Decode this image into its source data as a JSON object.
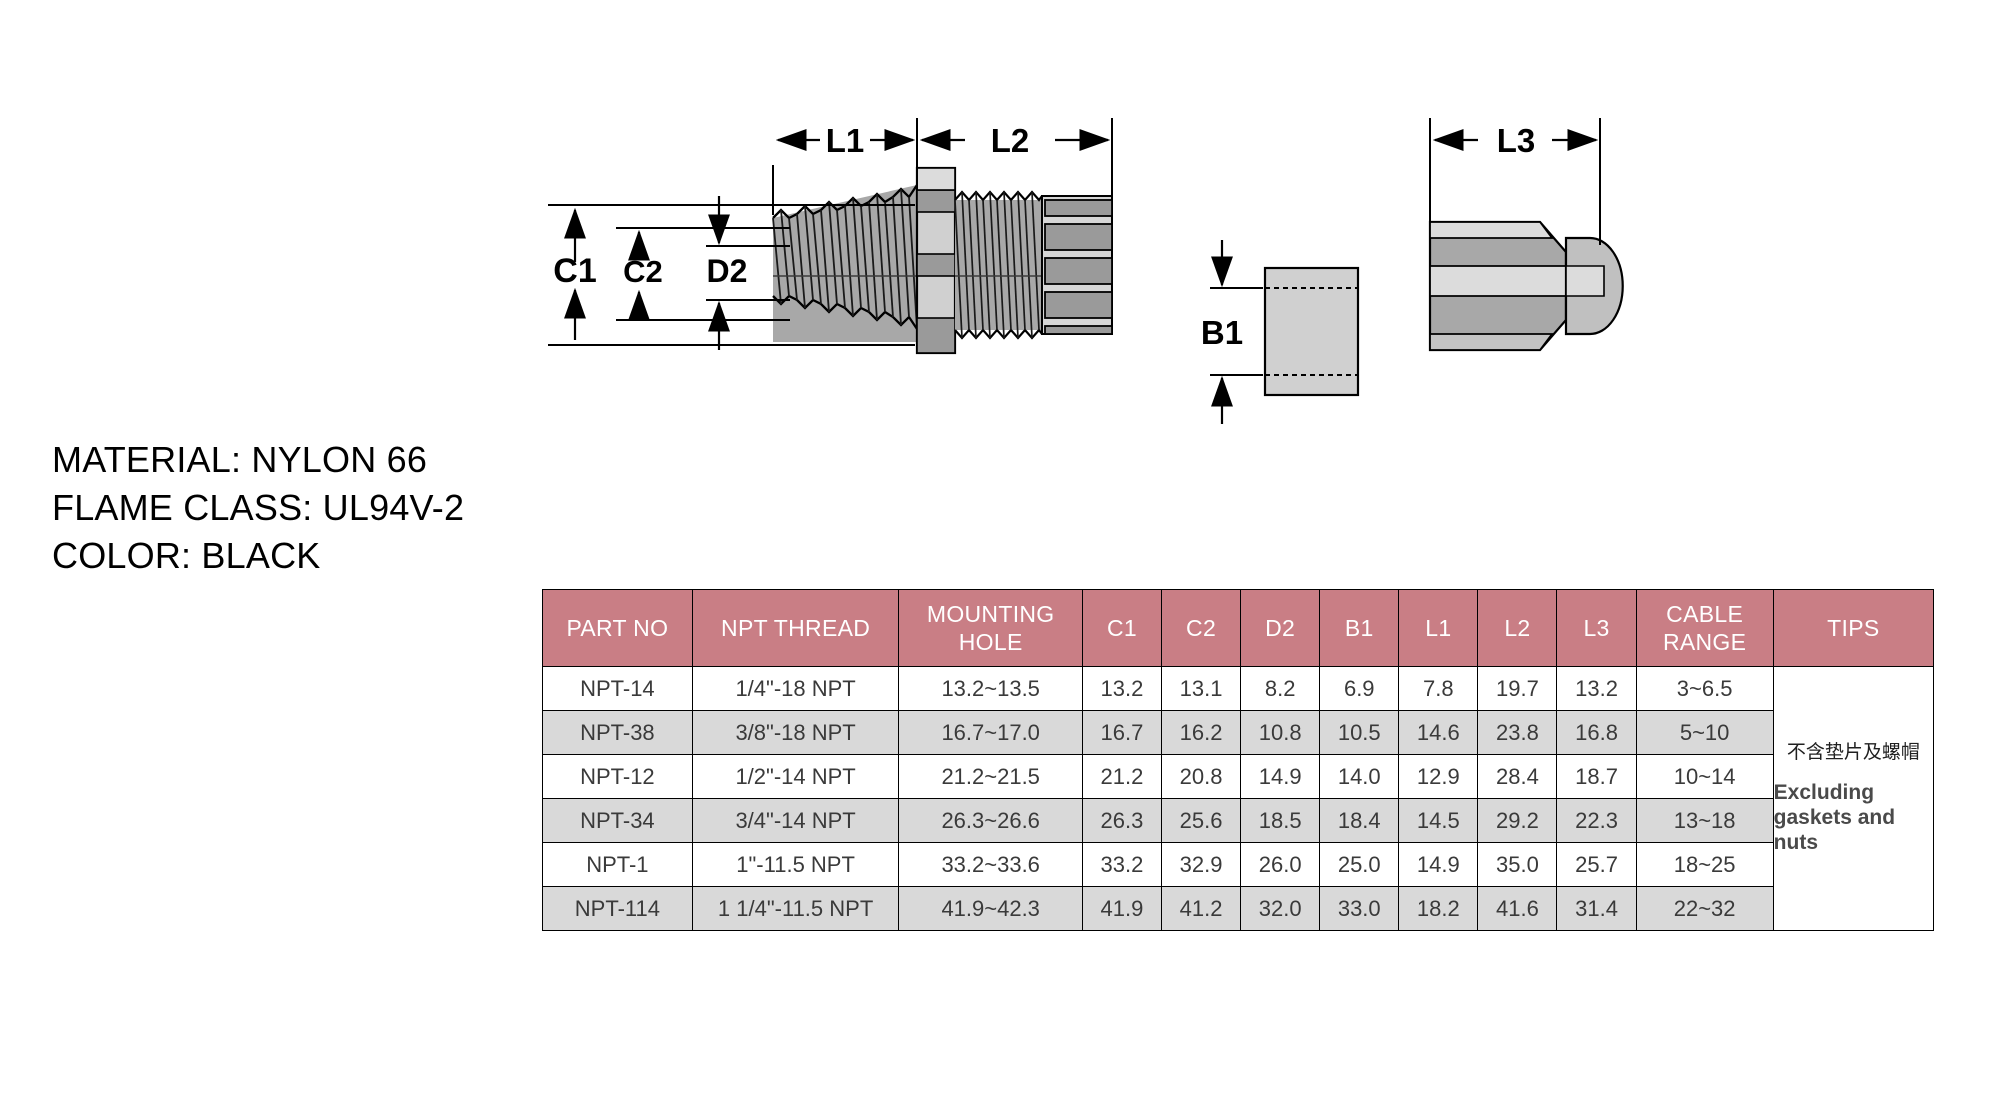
{
  "spec": {
    "lines": [
      "MATERIAL: NYLON 66",
      "FLAME CLASS: UL94V-2",
      "COLOR: BLACK"
    ]
  },
  "drawing": {
    "labels": {
      "l1": "L1",
      "l2": "L2",
      "l3": "L3",
      "c1": "C1",
      "c2": "C2",
      "d2": "D2",
      "b1": "B1"
    },
    "parts": {
      "body": "npt-cable-gland-body",
      "washer": "sealing-washer",
      "nut": "lock-nut"
    },
    "colors": {
      "line": "#000000",
      "fill_light": "#d0d0d0",
      "fill_mid": "#a8a8a8",
      "fill_dark": "#909090"
    }
  },
  "table": {
    "header_color": "#c97e85",
    "alt_row_color": "#d9d9d9",
    "headers": [
      "PART NO",
      "NPT THREAD",
      "MOUNTING HOLE",
      "C1",
      "C2",
      "D2",
      "B1",
      "L1",
      "L2",
      "L3",
      "CABLE RANGE",
      "TIPS"
    ],
    "headers_split": {
      "mounting_hole_1": "MOUNTING",
      "mounting_hole_2": "HOLE",
      "cable_range_1": "CABLE",
      "cable_range_2": "RANGE"
    },
    "rows": [
      {
        "part_no": "NPT-14",
        "npt_thread": "1/4\"-18 NPT",
        "mounting_hole": "13.2~13.5",
        "c1": "13.2",
        "c2": "13.1",
        "d2": "8.2",
        "b1": "6.9",
        "l1": "7.8",
        "l2": "19.7",
        "l3": "13.2",
        "cable_range": "3~6.5"
      },
      {
        "part_no": "NPT-38",
        "npt_thread": "3/8\"-18 NPT",
        "mounting_hole": "16.7~17.0",
        "c1": "16.7",
        "c2": "16.2",
        "d2": "10.8",
        "b1": "10.5",
        "l1": "14.6",
        "l2": "23.8",
        "l3": "16.8",
        "cable_range": "5~10"
      },
      {
        "part_no": "NPT-12",
        "npt_thread": "1/2\"-14 NPT",
        "mounting_hole": "21.2~21.5",
        "c1": "21.2",
        "c2": "20.8",
        "d2": "14.9",
        "b1": "14.0",
        "l1": "12.9",
        "l2": "28.4",
        "l3": "18.7",
        "cable_range": "10~14"
      },
      {
        "part_no": "NPT-34",
        "npt_thread": "3/4\"-14 NPT",
        "mounting_hole": "26.3~26.6",
        "c1": "26.3",
        "c2": "25.6",
        "d2": "18.5",
        "b1": "18.4",
        "l1": "14.5",
        "l2": "29.2",
        "l3": "22.3",
        "cable_range": "13~18"
      },
      {
        "part_no": "NPT-1",
        "npt_thread": "1\"-11.5 NPT",
        "mounting_hole": "33.2~33.6",
        "c1": "33.2",
        "c2": "32.9",
        "d2": "26.0",
        "b1": "25.0",
        "l1": "14.9",
        "l2": "35.0",
        "l3": "25.7",
        "cable_range": "18~25"
      },
      {
        "part_no": "NPT-114",
        "npt_thread": "1 1/4\"-11.5 NPT",
        "mounting_hole": "41.9~42.3",
        "c1": "41.9",
        "c2": "41.2",
        "d2": "32.0",
        "b1": "33.0",
        "l1": "18.2",
        "l2": "41.6",
        "l3": "31.4",
        "cable_range": "22~32"
      }
    ],
    "tips": {
      "chinese": "不含垫片及螺帽",
      "english": "Excluding gaskets and nuts"
    }
  }
}
